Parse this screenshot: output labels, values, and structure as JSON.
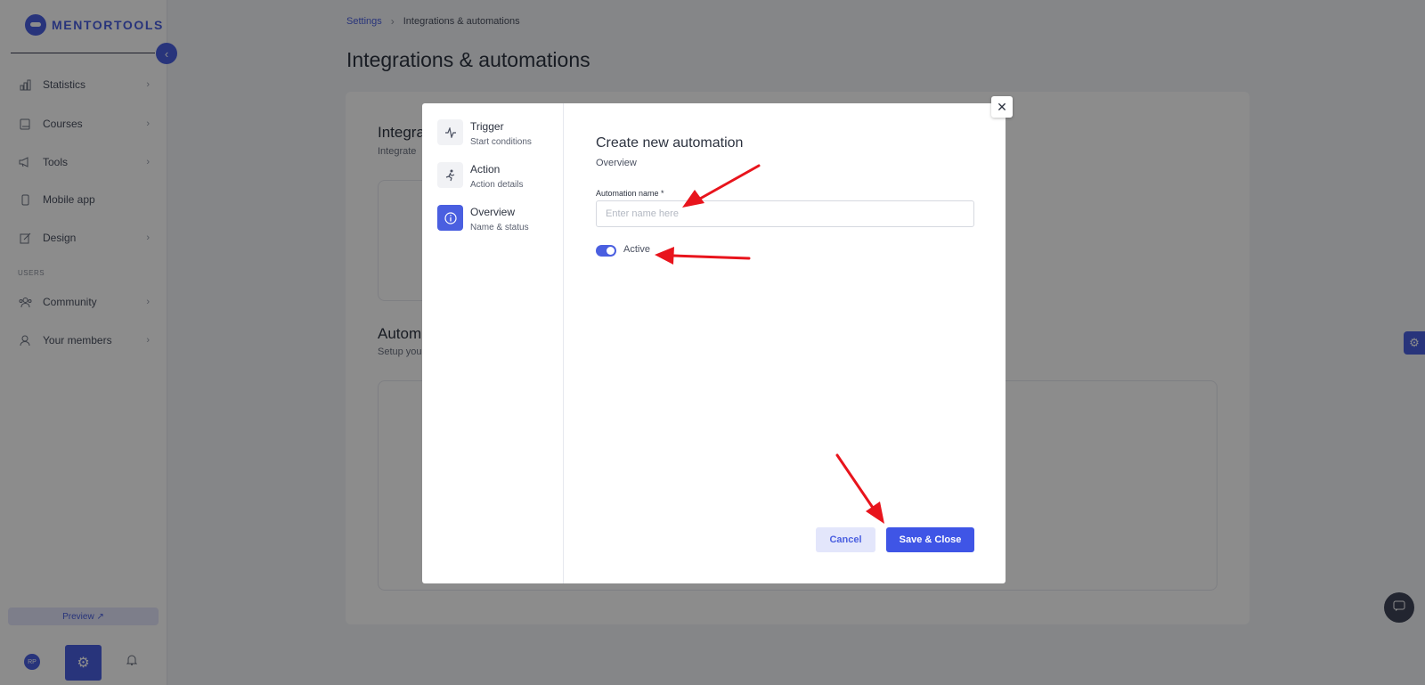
{
  "app": {
    "logo_text": "MENTORTOOLS"
  },
  "sidebar": {
    "items": [
      {
        "label": "Statistics",
        "icon": "bar-chart-icon",
        "has_submenu": true
      },
      {
        "label": "Courses",
        "icon": "book-icon",
        "has_submenu": true
      },
      {
        "label": "Tools",
        "icon": "megaphone-icon",
        "has_submenu": true
      },
      {
        "label": "Mobile app",
        "icon": "phone-icon",
        "has_submenu": false
      },
      {
        "label": "Design",
        "icon": "pencil-icon",
        "has_submenu": true
      }
    ],
    "section_label": "USERS",
    "user_items": [
      {
        "label": "Community",
        "icon": "people-icon",
        "has_submenu": true
      },
      {
        "label": "Your members",
        "icon": "person-icon",
        "has_submenu": true
      }
    ],
    "preview_label": "Preview ↗",
    "avatar_initials": "RP"
  },
  "breadcrumb": {
    "parent": "Settings",
    "current": "Integrations & automations"
  },
  "page": {
    "title": "Integrations & automations",
    "integrations_title": "Integra",
    "integrations_sub": "Integrate",
    "automations_title": "Autom",
    "automations_sub": "Setup you"
  },
  "modal": {
    "steps": [
      {
        "title": "Trigger",
        "subtitle": "Start conditions",
        "icon": "pulse-icon",
        "active": false
      },
      {
        "title": "Action",
        "subtitle": "Action details",
        "icon": "running-icon",
        "active": false
      },
      {
        "title": "Overview",
        "subtitle": "Name & status",
        "icon": "info-icon",
        "active": true
      }
    ],
    "title": "Create new automation",
    "subtitle": "Overview",
    "name_label": "Automation name *",
    "name_value": "",
    "name_placeholder": "Enter name here",
    "active_label": "Active",
    "active_on": true,
    "cancel_label": "Cancel",
    "save_label": "Save & Close"
  },
  "colors": {
    "accent": "#4a5fe0",
    "annotation": "#e8141c"
  }
}
